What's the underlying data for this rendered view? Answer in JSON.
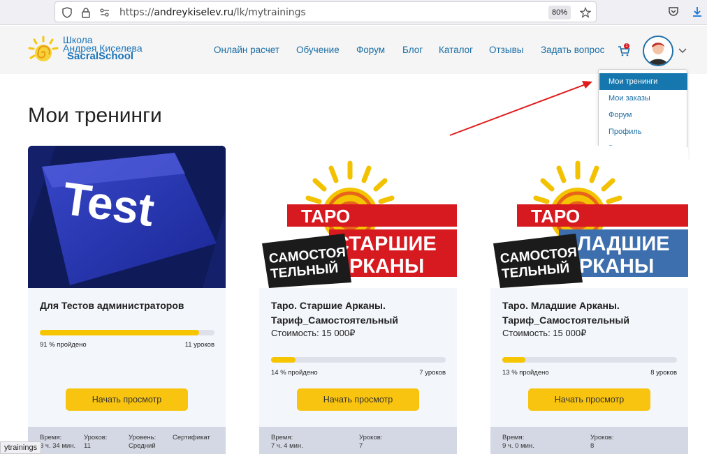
{
  "browser": {
    "url_prefix": "https://",
    "url_host": "andreykiselev.ru",
    "url_path": "/lk/mytrainings",
    "zoom": "80%"
  },
  "logo": {
    "line1": "Школа",
    "line2": "Андрея Киселева",
    "line3": "SacralSchool"
  },
  "nav": {
    "items": [
      "Онлайн расчет",
      "Обучение",
      "Форум",
      "Блог",
      "Каталог",
      "Отзывы",
      "Задать вопрос"
    ],
    "cart_count": "1"
  },
  "dropdown": {
    "items": [
      "Мои тренинги",
      "Мои заказы",
      "Форум",
      "Профиль",
      "Выход"
    ]
  },
  "page": {
    "title": "Мои тренинги"
  },
  "cards": [
    {
      "image_text": "Test",
      "title": "Для Тестов администраторов",
      "price": "",
      "progress": 0.91,
      "progress_label": "91 % пройдено",
      "lessons": "11 уроков",
      "button": "Начать просмотр",
      "footer": {
        "time_label": "Время:",
        "time_value": "3 ч. 34 мин.",
        "lessons_label": "Уроков:",
        "lessons_value": "11",
        "level_label": "Уровень:",
        "level_value": "Средний",
        "cert_label": "Сертификат"
      }
    },
    {
      "image_text": {
        "taro": "ТАРО",
        "line1": "СТАРШИЕ",
        "line2": "АРКАНЫ",
        "badge1": "САМОСТОЯ",
        "badge2": "ТЕЛЬНЫЙ"
      },
      "title": "Таро. Старшие Арканы. Тариф_Самостоятельный",
      "price": "Стоимость: 15 000₽",
      "progress": 0.14,
      "progress_label": "14 % пройдено",
      "lessons": "7 уроков",
      "button": "Начать просмотр",
      "footer": {
        "time_label": "Время:",
        "time_value": "7 ч. 4 мин.",
        "lessons_label": "Уроков:",
        "lessons_value": "7"
      }
    },
    {
      "image_text": {
        "taro": "ТАРО",
        "line1": "МЛАДШИЕ",
        "line2": "АРКАНЫ",
        "badge1": "САМОСТОЯ",
        "badge2": "ТЕЛЬНЫЙ"
      },
      "title": "Таро. Младшие Арканы. Тариф_Самостоятельный",
      "price": "Стоимость: 15 000₽",
      "progress": 0.13,
      "progress_label": "13 % пройдено",
      "lessons": "8 уроков",
      "button": "Начать просмотр",
      "footer": {
        "time_label": "Время:",
        "time_value": "9 ч. 0 мин.",
        "lessons_label": "Уроков:",
        "lessons_value": "8"
      }
    }
  ],
  "statusbar": {
    "text": "ytrainings"
  },
  "colors": {
    "link": "#1c6ea4",
    "accent": "#f8c40f",
    "active": "#1577ad",
    "red": "#d71920",
    "blue_banner": "#3d6fae"
  }
}
